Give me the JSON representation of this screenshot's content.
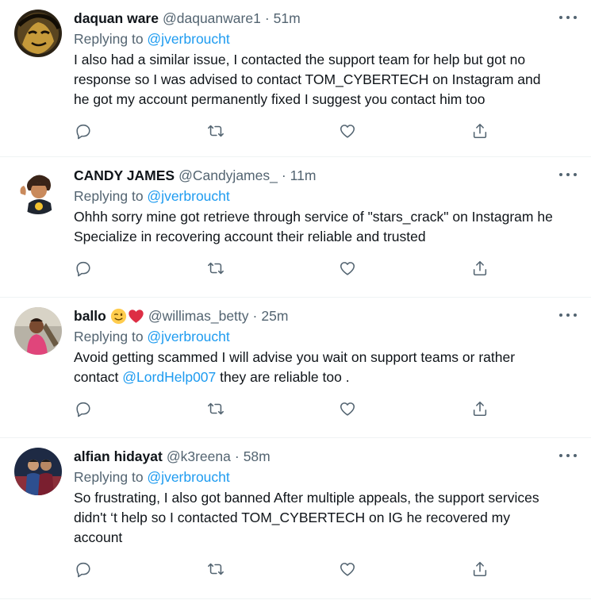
{
  "tweets": [
    {
      "name": "daquan ware",
      "handle": "@daquanware1",
      "separator": "·",
      "time": "51m",
      "replying_prefix": "Replying to ",
      "replying_to": "@jverbroucht",
      "text_parts": [
        {
          "text": "I also had a similar issue, I contacted the support team for help but got no response so I was advised to contact TOM_CYBERTECH on Instagram and he got my account permanently fixed I suggest you contact him too"
        }
      ],
      "avatar_icon": "avatar-daquan"
    },
    {
      "name": "CANDY JAMES",
      "handle": "@Candyjames_",
      "separator": "·",
      "time": "11m",
      "replying_prefix": "Replying to ",
      "replying_to": "@jverbroucht",
      "text_parts": [
        {
          "text": "Ohhh sorry mine got retrieve through service of \"stars_crack\" on Instagram he Specialize in recovering account their reliable and trusted"
        }
      ],
      "avatar_icon": "avatar-candy"
    },
    {
      "name": "ballo",
      "name_emojis": [
        "winking-face-icon",
        "red-heart-icon"
      ],
      "handle": "@willimas_betty",
      "separator": "·",
      "time": "25m",
      "replying_prefix": "Replying to ",
      "replying_to": "@jverbroucht",
      "text_parts": [
        {
          "text": "Avoid getting scammed I will advise you wait on support teams or rather contact "
        },
        {
          "text": "@LordHelp007",
          "link": true
        },
        {
          "text": " they are reliable too ."
        }
      ],
      "avatar_icon": "avatar-ballo"
    },
    {
      "name": "alfian hidayat",
      "handle": "@k3reena",
      "separator": "·",
      "time": "58m",
      "replying_prefix": "Replying to ",
      "replying_to": "@jverbroucht",
      "text_parts": [
        {
          "text": "So frustrating, I also got banned After multiple appeals, the support services didn't ‘t help so I contacted TOM_CYBERTECH on IG he recovered my account"
        }
      ],
      "avatar_icon": "avatar-alfian"
    }
  ],
  "colors": {
    "accent": "#1d9bf0",
    "secondary_text": "#536471",
    "primary_text": "#0f1419",
    "divider": "#eff3f4"
  },
  "action_icons": [
    "reply-icon",
    "retweet-icon",
    "like-icon",
    "share-icon"
  ]
}
